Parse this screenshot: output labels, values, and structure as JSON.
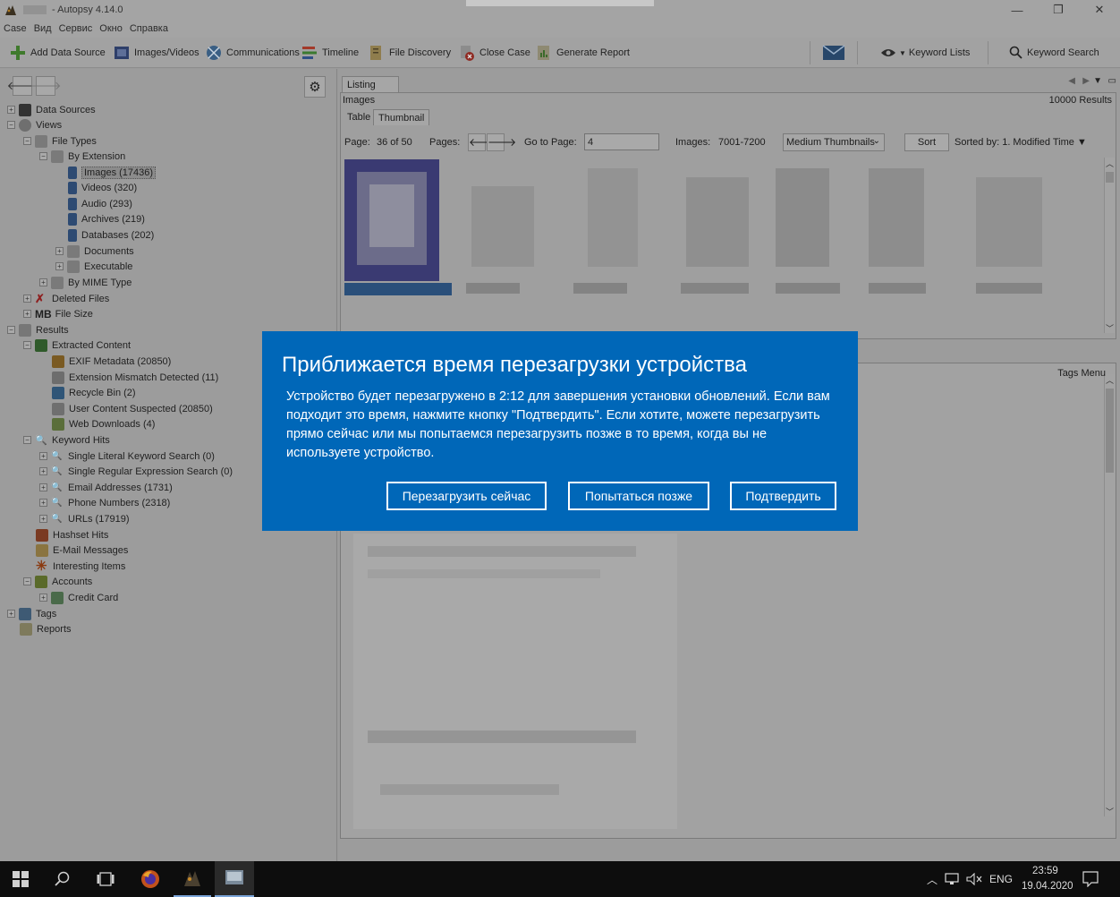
{
  "window": {
    "title": "- Autopsy 4.14.0",
    "minimize": "—",
    "restore": "❐",
    "close": "✕"
  },
  "menu": [
    "Case",
    "Вид",
    "Сервис",
    "Окно",
    "Справка"
  ],
  "toolbar": {
    "add_data_source": "Add Data Source",
    "images_videos": "Images/Videos",
    "communications": "Communications",
    "timeline": "Timeline",
    "file_discovery": "File Discovery",
    "close_case": "Close Case",
    "generate_report": "Generate Report",
    "keyword_lists": "Keyword Lists",
    "keyword_search": "Keyword Search"
  },
  "tree": {
    "data_sources": "Data Sources",
    "views": "Views",
    "file_types": "File Types",
    "by_extension": "By Extension",
    "images": "Images (17436)",
    "videos": "Videos (320)",
    "audio": "Audio (293)",
    "archives": "Archives (219)",
    "databases": "Databases (202)",
    "documents": "Documents",
    "executable": "Executable",
    "by_mime": "By MIME Type",
    "deleted_files": "Deleted Files",
    "mb": "MB",
    "file_size": "File Size",
    "results": "Results",
    "extracted_content": "Extracted Content",
    "exif": "EXIF Metadata (20850)",
    "ext_mismatch": "Extension Mismatch Detected (11)",
    "recycle_bin": "Recycle Bin (2)",
    "user_content": "User Content Suspected (20850)",
    "web_downloads": "Web Downloads (4)",
    "keyword_hits": "Keyword Hits",
    "single_literal": "Single Literal Keyword Search (0)",
    "single_regex": "Single Regular Expression Search (0)",
    "email_addresses": "Email Addresses (1731)",
    "phone_numbers": "Phone Numbers (2318)",
    "urls": "URLs (17919)",
    "hashset_hits": "Hashset Hits",
    "email_messages": "E-Mail Messages",
    "interesting_items": "Interesting Items",
    "accounts": "Accounts",
    "credit_card": "Credit Card",
    "tags": "Tags",
    "reports": "Reports"
  },
  "listing": {
    "tab": "Listing",
    "images_label": "Images",
    "results_count": "10000  Results",
    "subtab_table": "Table",
    "subtab_thumbnail": "Thumbnail",
    "page_label": "Page:",
    "page_value": "36 of 50",
    "pages_label": "Pages:",
    "goto_label": "Go to Page:",
    "goto_value": "4",
    "images_range_label": "Images:",
    "images_range": "7001-7200",
    "thumb_size": "Medium Thumbnails",
    "sort_button": "Sort",
    "sorted_by": "Sorted by: 1. Modified Time ▼"
  },
  "content": {
    "tags_menu": "Tags Menu"
  },
  "dialog": {
    "title": "Приближается время перезагрузки устройства",
    "body": "Устройство будет перезагружено в 2:12 для завершения установки обновлений. Если вам подходит это время, нажмите кнопку \"Подтвердить\". Если хотите, можете перезагрузить прямо сейчас или мы попытаемся перезагрузить позже в то время, когда вы не используете устройство.",
    "restart_now": "Перезагрузить сейчас",
    "try_later": "Попытаться позже",
    "confirm": "Подтвердить",
    "accent_color": "#0067b8"
  },
  "taskbar": {
    "time": "23:59",
    "date": "19.04.2020",
    "lang": "ENG"
  }
}
